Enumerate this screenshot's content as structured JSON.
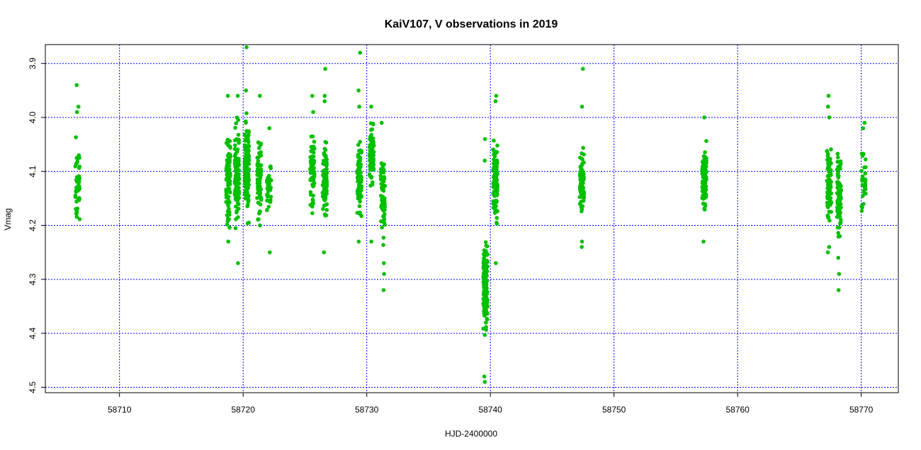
{
  "chart_data": {
    "type": "scatter",
    "title": "KaiV107, V observations in 2019",
    "xlabel": "HJD-2400000",
    "ylabel": "Vmag",
    "xlim": [
      58704,
      58773
    ],
    "ylim": [
      4.51,
      3.865
    ],
    "y_reversed": true,
    "xticks": [
      58710,
      58720,
      58730,
      58740,
      58750,
      58760,
      58770
    ],
    "yticks": [
      3.9,
      4.0,
      4.1,
      4.2,
      4.3,
      4.4,
      4.5
    ],
    "grid": true,
    "colors": {
      "points": "#00c000",
      "grid": "#0000ff",
      "axis": "#000000"
    },
    "clusters": [
      {
        "x": 58706.6,
        "n": 55,
        "lo": 4.01,
        "hi": 4.24,
        "extra": [
          3.94,
          3.98,
          3.99
        ]
      },
      {
        "x": 58718.8,
        "n": 90,
        "lo": 4.0,
        "hi": 4.23,
        "extra": [
          3.96,
          4.23
        ]
      },
      {
        "x": 58719.5,
        "n": 110,
        "lo": 3.98,
        "hi": 4.23,
        "extra": [
          3.96,
          4.27
        ]
      },
      {
        "x": 58720.3,
        "n": 130,
        "lo": 3.97,
        "hi": 4.22,
        "extra": [
          3.87,
          3.95
        ]
      },
      {
        "x": 58721.3,
        "n": 70,
        "lo": 4.02,
        "hi": 4.21,
        "extra": [
          3.96,
          4.2
        ]
      },
      {
        "x": 58722.1,
        "n": 40,
        "lo": 4.06,
        "hi": 4.19,
        "extra": [
          4.02,
          4.25
        ]
      },
      {
        "x": 58725.6,
        "n": 70,
        "lo": 4.01,
        "hi": 4.19,
        "extra": [
          3.96,
          3.99
        ]
      },
      {
        "x": 58726.6,
        "n": 100,
        "lo": 4.01,
        "hi": 4.21,
        "extra": [
          3.91,
          3.96,
          3.97,
          4.25
        ]
      },
      {
        "x": 58729.4,
        "n": 80,
        "lo": 4.02,
        "hi": 4.2,
        "extra": [
          3.95,
          3.98,
          4.23
        ]
      },
      {
        "x": 58729.5,
        "n": 0,
        "lo": 4.0,
        "hi": 4.0,
        "extra": [
          3.88
        ]
      },
      {
        "x": 58730.4,
        "n": 80,
        "lo": 3.99,
        "hi": 4.15,
        "extra": [
          3.98,
          4.23
        ]
      },
      {
        "x": 58731.3,
        "n": 60,
        "lo": 4.04,
        "hi": 4.25,
        "extra": [
          4.01,
          4.27,
          4.29,
          4.32
        ]
      },
      {
        "x": 58739.6,
        "n": 130,
        "lo": 4.2,
        "hi": 4.42,
        "extra": [
          4.04,
          4.08,
          4.48,
          4.49
        ]
      },
      {
        "x": 58740.4,
        "n": 110,
        "lo": 4.01,
        "hi": 4.24,
        "extra": [
          3.96,
          3.97,
          4.27
        ]
      },
      {
        "x": 58747.4,
        "n": 80,
        "lo": 4.03,
        "hi": 4.21,
        "extra": [
          3.91,
          3.98,
          4.23,
          4.24
        ]
      },
      {
        "x": 58757.3,
        "n": 90,
        "lo": 4.03,
        "hi": 4.2,
        "extra": [
          4.0,
          4.23
        ]
      },
      {
        "x": 58767.4,
        "n": 80,
        "lo": 4.03,
        "hi": 4.22,
        "extra": [
          3.96,
          3.98,
          4.0,
          4.24,
          4.25
        ]
      },
      {
        "x": 58768.2,
        "n": 80,
        "lo": 4.04,
        "hi": 4.24,
        "extra": [
          4.26,
          4.29,
          4.32
        ]
      },
      {
        "x": 58770.2,
        "n": 30,
        "lo": 4.05,
        "hi": 4.2,
        "extra": [
          4.01,
          4.02
        ]
      }
    ]
  }
}
